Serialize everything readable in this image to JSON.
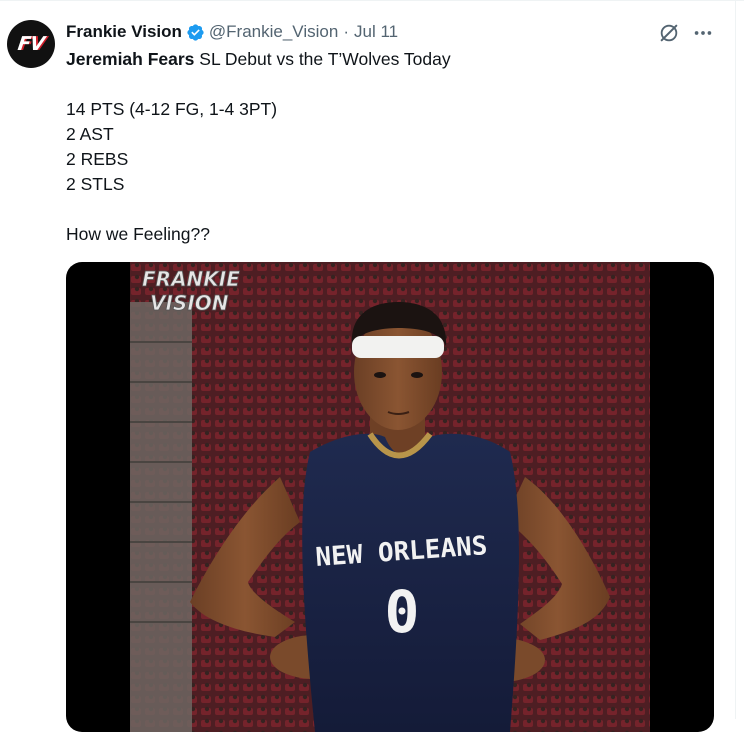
{
  "author": {
    "name": "Frankie Vision",
    "handle": "@Frankie_Vision",
    "separator": "·",
    "date": "Jul 11",
    "avatar_text": "FV",
    "verified_color": "#1d9bf0"
  },
  "actions": {
    "grok_icon": "grok-icon",
    "more_icon": "more-icon"
  },
  "tweet": {
    "line1_bold": "Jeremiah Fears",
    "line1_rest": " SL Debut vs the T’Wolves Today",
    "stats": [
      "14 PTS (4-12 FG, 1-4 3PT)",
      "2 AST",
      "2 REBS",
      "2 STLS"
    ],
    "question": "How we Feeling??"
  },
  "media": {
    "watermark_line1": "FRANKIE",
    "watermark_line2": "VISION",
    "jersey_city": "NEW ORLEANS",
    "jersey_number": "0"
  }
}
